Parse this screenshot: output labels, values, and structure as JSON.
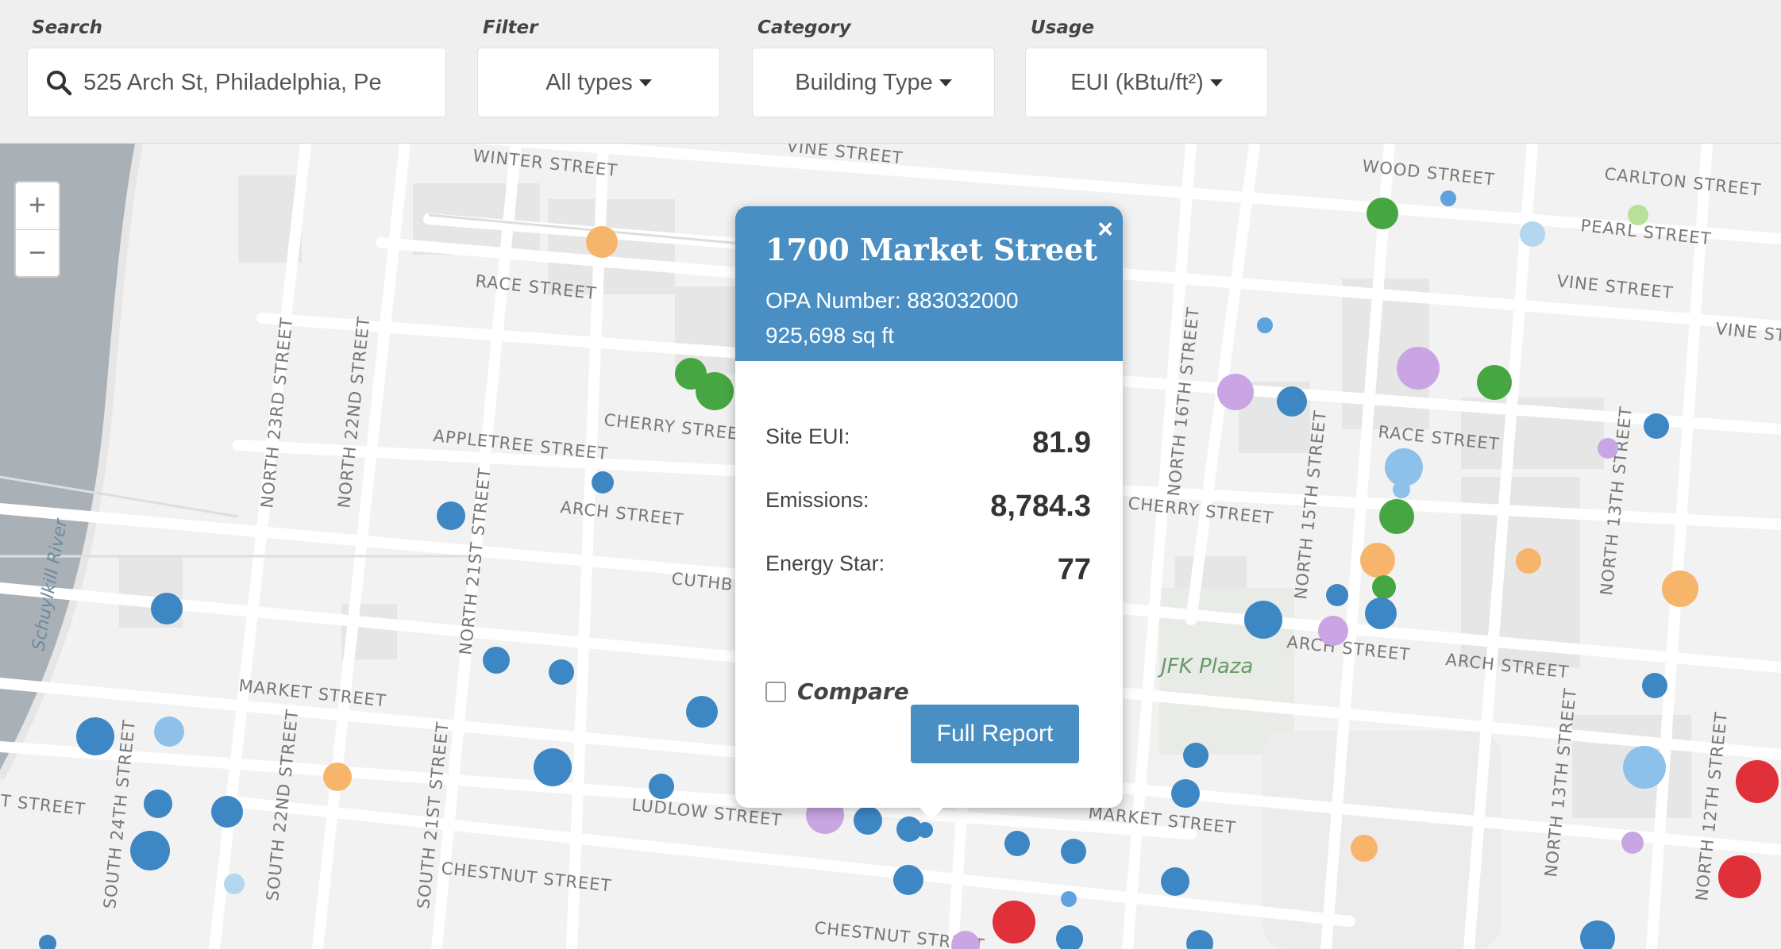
{
  "toolbar": {
    "search": {
      "label": "Search",
      "value": "525 Arch St, Philadelphia, Pe"
    },
    "filter": {
      "label": "Filter",
      "value": "All types"
    },
    "category": {
      "label": "Category",
      "value": "Building Type"
    },
    "usage": {
      "label": "Usage",
      "value": "EUI (kBtu/ft²)"
    }
  },
  "map": {
    "zoom_in": "+",
    "zoom_out": "−",
    "river_label": "Schuylkill River",
    "park_label": "JFK Plaza",
    "colors": {
      "blue": "#3d87c4",
      "light_blue": "#8ec1ea",
      "green": "#46a742",
      "light_green": "#b8e09a",
      "orange": "#f7b56b",
      "purple": "#c9a6e3",
      "red": "#e0303a"
    },
    "streets": [
      "WINTER STREET",
      "VINE STREET",
      "WOOD STREET",
      "CARLTON STREET",
      "PEARL STREET",
      "VINE STREET",
      "VINE ST",
      "RACE STREET",
      "RACE STREET",
      "CHERRY STREET",
      "APPLETREE STREET",
      "CHERRY STREET",
      "ARCH STREET",
      "ARCH STREET",
      "ARCH STREET",
      "MARKET STREET",
      "MARKET STREET",
      "LUDLOW STREET",
      "CHESTNUT STREET",
      "CHESTNUT STREET",
      "NORTH 23RD STREET",
      "NORTH 22ND STREET",
      "NORTH 21ST STREET",
      "NORTH 16TH STREET",
      "NORTH 15TH STREET",
      "NORTH 13TH STREET",
      "SOUTH 24TH STREET",
      "SOUTH 22ND STREET",
      "SOUTH 21ST STREET",
      "NORTH 13TH STREET",
      "NORTH 12TH STREET",
      "CUTHB",
      "T STREET"
    ]
  },
  "popup": {
    "close": "×",
    "title": "1700 Market Street",
    "opa": "OPA Number: 883032000",
    "sqft": "925,698 sq ft",
    "metrics": [
      {
        "label": "Site EUI:",
        "value": "81.9"
      },
      {
        "label": "Emissions:",
        "value": "8,784.3"
      },
      {
        "label": "Energy Star:",
        "value": "77"
      }
    ],
    "compare_label": "Compare",
    "report_button": "Full Report"
  }
}
